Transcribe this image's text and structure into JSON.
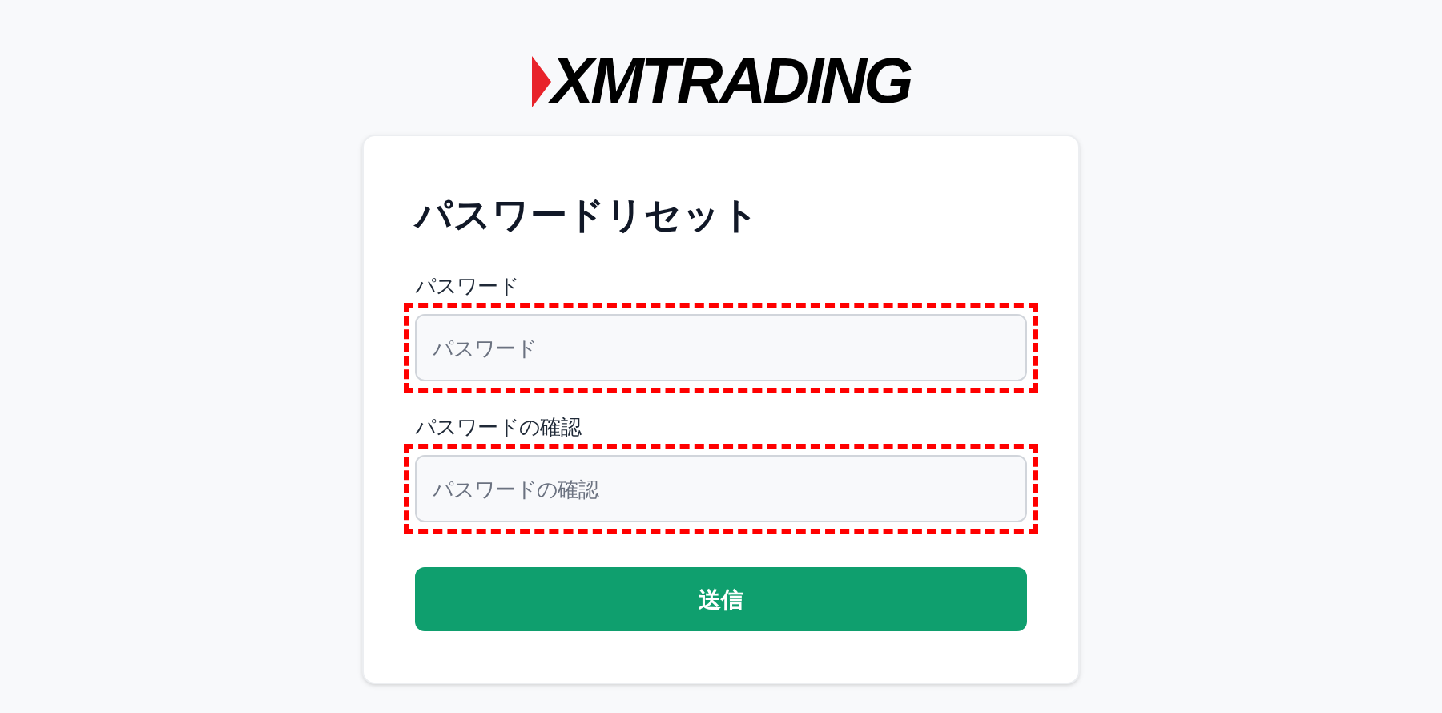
{
  "logo": {
    "text": "XMTRADING"
  },
  "card": {
    "title": "パスワードリセット",
    "fields": [
      {
        "label": "パスワード",
        "placeholder": "パスワード",
        "highlighted": true
      },
      {
        "label": "パスワードの確認",
        "placeholder": "パスワードの確認",
        "highlighted": true
      }
    ],
    "submit_button": "送信"
  }
}
